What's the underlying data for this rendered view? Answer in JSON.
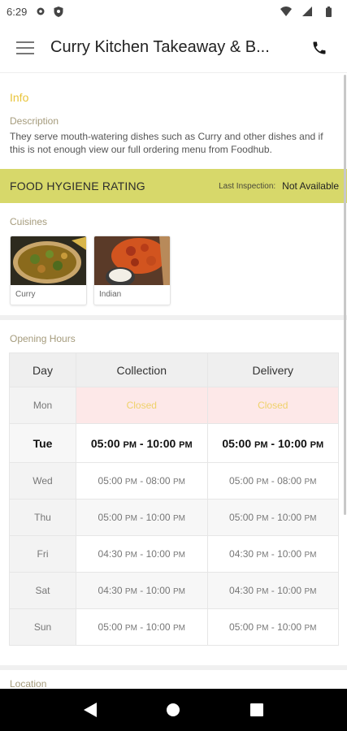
{
  "status_bar": {
    "time": "6:29",
    "icons": [
      "gear-icon",
      "shield-icon",
      "wifi-icon",
      "signal-icon",
      "battery-icon"
    ]
  },
  "app_bar": {
    "menu_icon": "hamburger-icon",
    "title": "Curry Kitchen Takeaway & B...",
    "call_icon": "phone-icon"
  },
  "info": {
    "heading": "Info",
    "description_label": "Description",
    "description_text": "They serve mouth-watering dishes such as Curry  and other dishes and if this is not enough view our full ordering menu from Foodhub."
  },
  "hygiene": {
    "title": "FOOD HYGIENE RATING",
    "inspection_label": "Last Inspection:",
    "inspection_value": "Not Available"
  },
  "cuisines": {
    "label": "Cuisines",
    "items": [
      {
        "name": "Curry"
      },
      {
        "name": "Indian"
      }
    ]
  },
  "opening_hours": {
    "label": "Opening Hours",
    "headers": [
      "Day",
      "Collection",
      "Delivery"
    ],
    "rows": [
      {
        "day": "Mon",
        "collection": "Closed",
        "delivery": "Closed"
      },
      {
        "day": "Tue",
        "c_start": "05:00",
        "c_start_ampm": "PM",
        "c_end": "10:00",
        "c_end_ampm": "PM",
        "d_start": "05:00",
        "d_start_ampm": "PM",
        "d_end": "10:00",
        "d_end_ampm": "PM"
      },
      {
        "day": "Wed",
        "c_start": "05:00",
        "c_start_ampm": "PM",
        "c_end": "08:00",
        "c_end_ampm": "PM",
        "d_start": "05:00",
        "d_start_ampm": "PM",
        "d_end": "08:00",
        "d_end_ampm": "PM"
      },
      {
        "day": "Thu",
        "c_start": "05:00",
        "c_start_ampm": "PM",
        "c_end": "10:00",
        "c_end_ampm": "PM",
        "d_start": "05:00",
        "d_start_ampm": "PM",
        "d_end": "10:00",
        "d_end_ampm": "PM"
      },
      {
        "day": "Fri",
        "c_start": "04:30",
        "c_start_ampm": "PM",
        "c_end": "10:00",
        "c_end_ampm": "PM",
        "d_start": "04:30",
        "d_start_ampm": "PM",
        "d_end": "10:00",
        "d_end_ampm": "PM"
      },
      {
        "day": "Sat",
        "c_start": "04:30",
        "c_start_ampm": "PM",
        "c_end": "10:00",
        "c_end_ampm": "PM",
        "d_start": "04:30",
        "d_start_ampm": "PM",
        "d_end": "10:00",
        "d_end_ampm": "PM"
      },
      {
        "day": "Sun",
        "c_start": "05:00",
        "c_start_ampm": "PM",
        "c_end": "10:00",
        "c_end_ampm": "PM",
        "d_start": "05:00",
        "d_start_ampm": "PM",
        "d_end": "10:00",
        "d_end_ampm": "PM"
      }
    ]
  },
  "location": {
    "label": "Location"
  },
  "nav_bar": {
    "icons": [
      "back-icon",
      "home-icon",
      "recents-icon"
    ]
  },
  "colors": {
    "accent": "#e8c43a",
    "hygiene_bg": "#d7d86a",
    "closed_bg": "#fde8e8",
    "label": "#a59b7c"
  }
}
